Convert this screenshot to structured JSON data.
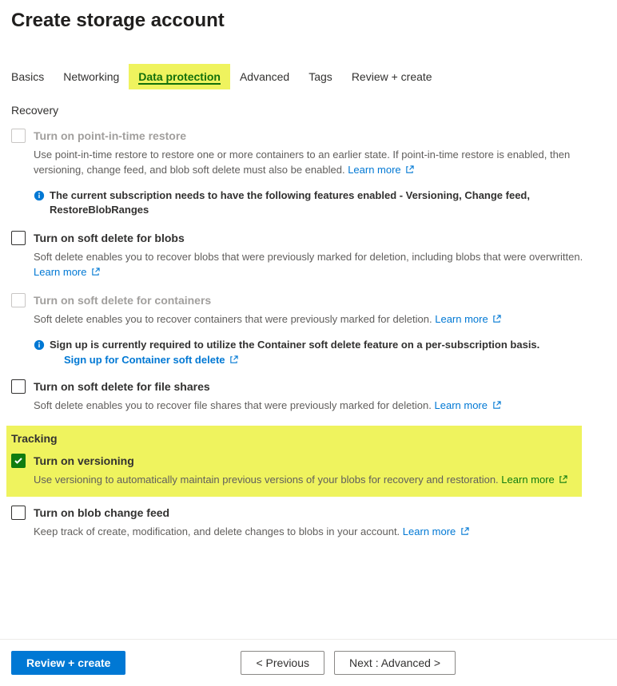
{
  "title": "Create storage account",
  "tabs": [
    {
      "label": "Basics"
    },
    {
      "label": "Networking"
    },
    {
      "label": "Data protection",
      "active": true
    },
    {
      "label": "Advanced"
    },
    {
      "label": "Tags"
    },
    {
      "label": "Review + create"
    }
  ],
  "sections": {
    "recovery": {
      "heading": "Recovery",
      "items": [
        {
          "label": "Turn on point-in-time restore",
          "disabled": true,
          "desc": "Use point-in-time restore to restore one or more containers to an earlier state. If point-in-time restore is enabled, then versioning, change feed, and blob soft delete must also be enabled.",
          "learn_more": "Learn more",
          "info": "The current subscription needs to have the following features enabled - Versioning, Change feed, RestoreBlobRanges"
        },
        {
          "label": "Turn on soft delete for blobs",
          "desc": "Soft delete enables you to recover blobs that were previously marked for deletion, including blobs that were overwritten.",
          "learn_more": "Learn more"
        },
        {
          "label": "Turn on soft delete for containers",
          "disabled": true,
          "desc": "Soft delete enables you to recover containers that were previously marked for deletion.",
          "learn_more": "Learn more",
          "info": "Sign up is currently required to utilize the Container soft delete feature on a per-subscription basis.",
          "info_link": "Sign up for Container soft delete"
        },
        {
          "label": "Turn on soft delete for file shares",
          "desc": "Soft delete enables you to recover file shares that were previously marked for deletion.",
          "learn_more": "Learn more"
        }
      ]
    },
    "tracking": {
      "heading": "Tracking",
      "items": [
        {
          "label": "Turn on versioning",
          "checked": true,
          "highlight": true,
          "desc": "Use versioning to automatically maintain previous versions of your blobs for recovery and restoration.",
          "learn_more": "Learn more"
        },
        {
          "label": "Turn on blob change feed",
          "desc": "Keep track of create, modification, and delete changes to blobs in your account.",
          "learn_more": "Learn more"
        }
      ]
    }
  },
  "footer": {
    "review": "Review + create",
    "previous": "<  Previous",
    "next": "Next : Advanced  >"
  }
}
